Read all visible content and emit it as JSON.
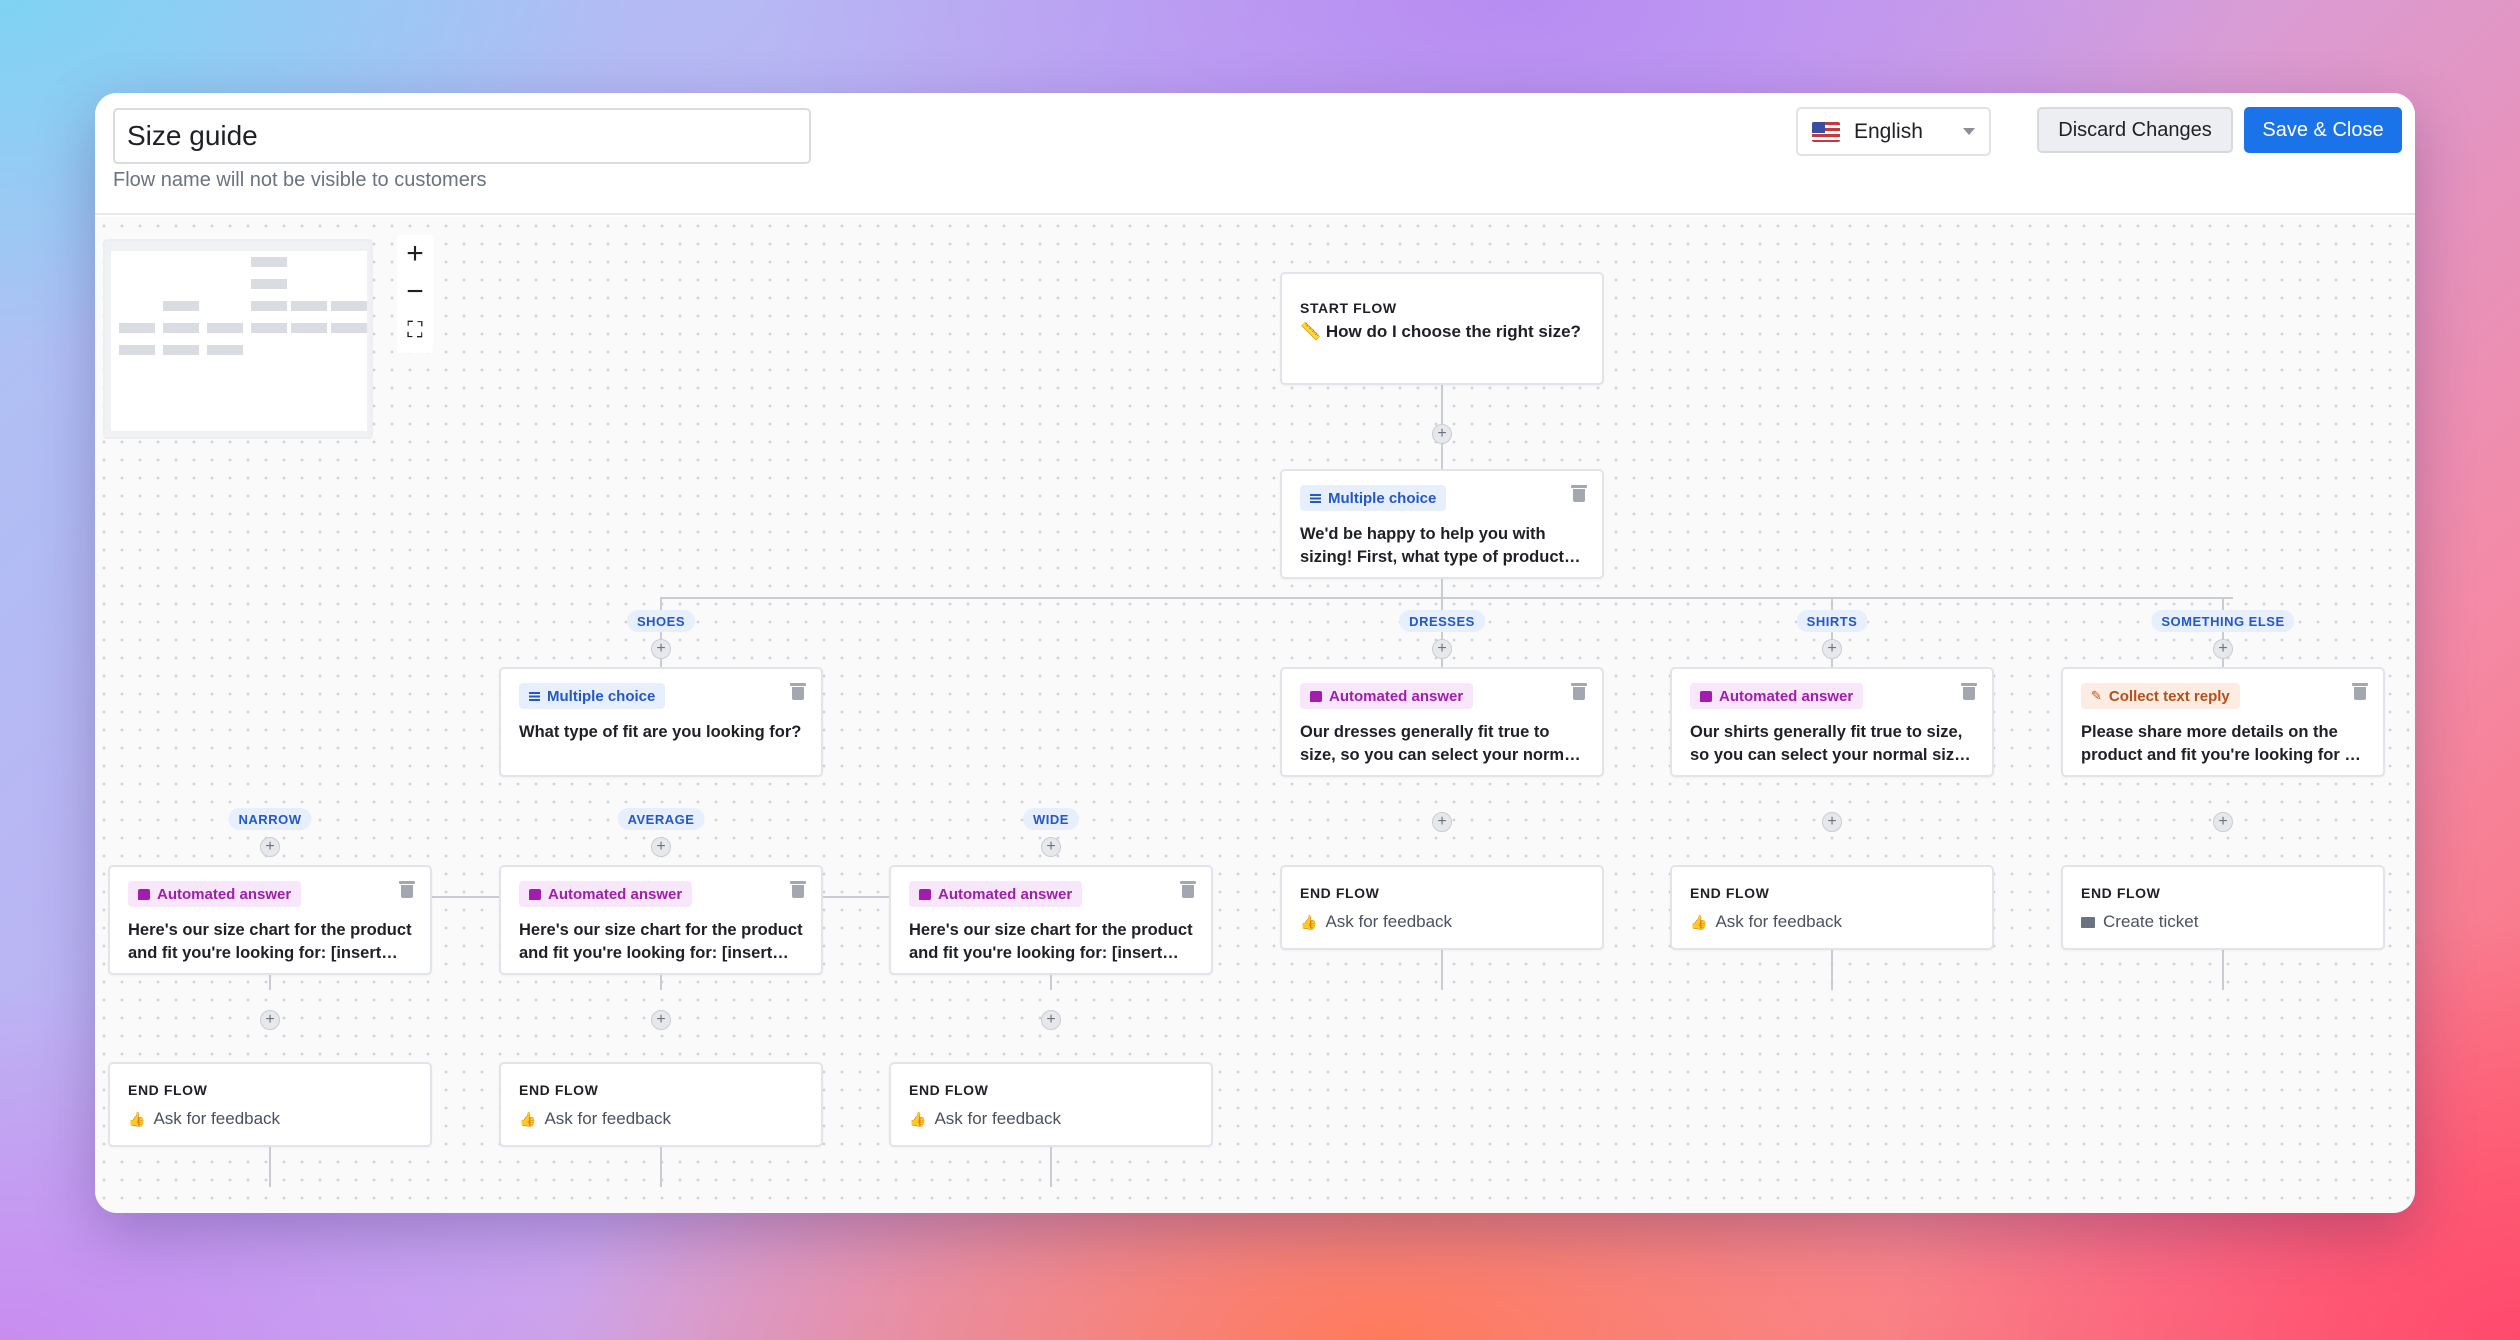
{
  "header": {
    "flow_name": "Size guide",
    "flow_hint": "Flow name will not be visible to customers",
    "language": "English",
    "discard_label": "Discard Changes",
    "save_label": "Save & Close"
  },
  "zoom": {
    "zoom_in": "+",
    "zoom_out": "−",
    "fit": "⛶"
  },
  "start": {
    "title": "START FLOW",
    "text": "📏 How do I choose the right size?"
  },
  "root_choice": {
    "tag": "Multiple choice",
    "text": "We'd be happy to help you with sizing! First, what type of product are you shopping for?"
  },
  "branches": {
    "shoes": "SHOES",
    "dresses": "DRESSES",
    "shirts": "SHIRTS",
    "something_else": "SOMETHING ELSE",
    "narrow": "NARROW",
    "average": "AVERAGE",
    "wide": "WIDE"
  },
  "shoes_choice": {
    "tag": "Multiple choice",
    "text": "What type of fit are you looking for?"
  },
  "dresses_answer": {
    "tag": "Automated answer",
    "text": "Our dresses generally fit true to size, so you can select your normal size with confidence."
  },
  "shirts_answer": {
    "tag": "Automated answer",
    "text": "Our shirts generally fit true to size, so you can select your normal size with confidence."
  },
  "else_collect": {
    "tag": "Collect text reply",
    "text": "Please share more details on the product and fit you're looking for so we can help."
  },
  "narrow_answer": {
    "tag": "Automated answer",
    "text": "Here's our size chart for the product and fit you're looking for: [insert size chart]"
  },
  "average_answer": {
    "tag": "Automated answer",
    "text": "Here's our size chart for the product and fit you're looking for: [insert size chart]"
  },
  "wide_answer": {
    "tag": "Automated answer",
    "text": "Here's our size chart for the product and fit you're looking for: [insert size chart]"
  },
  "end_flows": {
    "label": "END FLOW",
    "feedback": "Ask for feedback",
    "ticket": "Create ticket"
  }
}
